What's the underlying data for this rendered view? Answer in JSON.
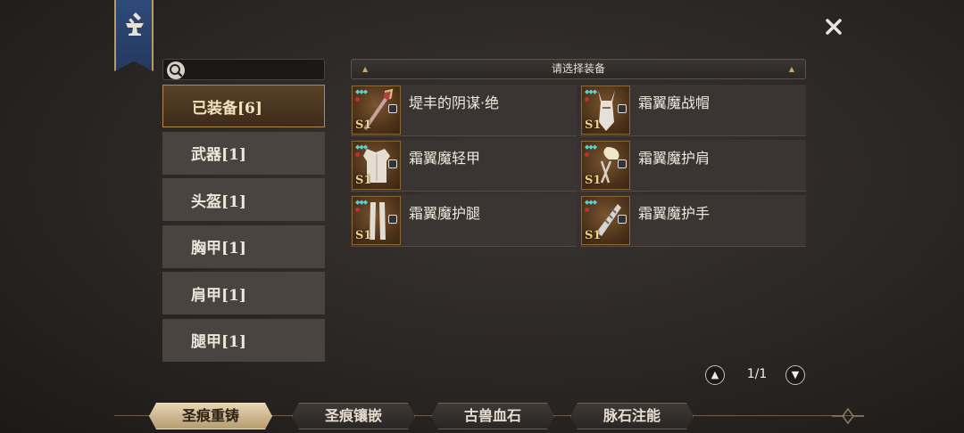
{
  "search": {
    "placeholder": "",
    "value": ""
  },
  "header": {
    "title": "请选择装备"
  },
  "categories": [
    {
      "label": "已装备[6]",
      "active": true
    },
    {
      "label": "武器[1]",
      "active": false
    },
    {
      "label": "头盔[1]",
      "active": false
    },
    {
      "label": "胸甲[1]",
      "active": false
    },
    {
      "label": "肩甲[1]",
      "active": false
    },
    {
      "label": "腿甲[1]",
      "active": false
    }
  ],
  "equipment": [
    {
      "name": "堤丰的阴谋·绝",
      "tier": "S1",
      "icon": "staff-icon"
    },
    {
      "name": "霜翼魔战帽",
      "tier": "S1",
      "icon": "helmet-icon"
    },
    {
      "name": "霜翼魔轻甲",
      "tier": "S1",
      "icon": "chest-armor-icon"
    },
    {
      "name": "霜翼魔护肩",
      "tier": "S1",
      "icon": "pauldron-icon"
    },
    {
      "name": "霜翼魔护腿",
      "tier": "S1",
      "icon": "leg-armor-icon"
    },
    {
      "name": "霜翼魔护手",
      "tier": "S1",
      "icon": "gauntlet-icon"
    }
  ],
  "pager": {
    "text": "1/1"
  },
  "tabs": [
    {
      "label": "圣痕重铸",
      "active": true
    },
    {
      "label": "圣痕镶嵌",
      "active": false
    },
    {
      "label": "古兽血石",
      "active": false
    },
    {
      "label": "脉石注能",
      "active": false
    }
  ],
  "colors": {
    "accent": "#b08a55",
    "banner": "#2f4a7a",
    "active_tab": "#e6d4b2"
  }
}
